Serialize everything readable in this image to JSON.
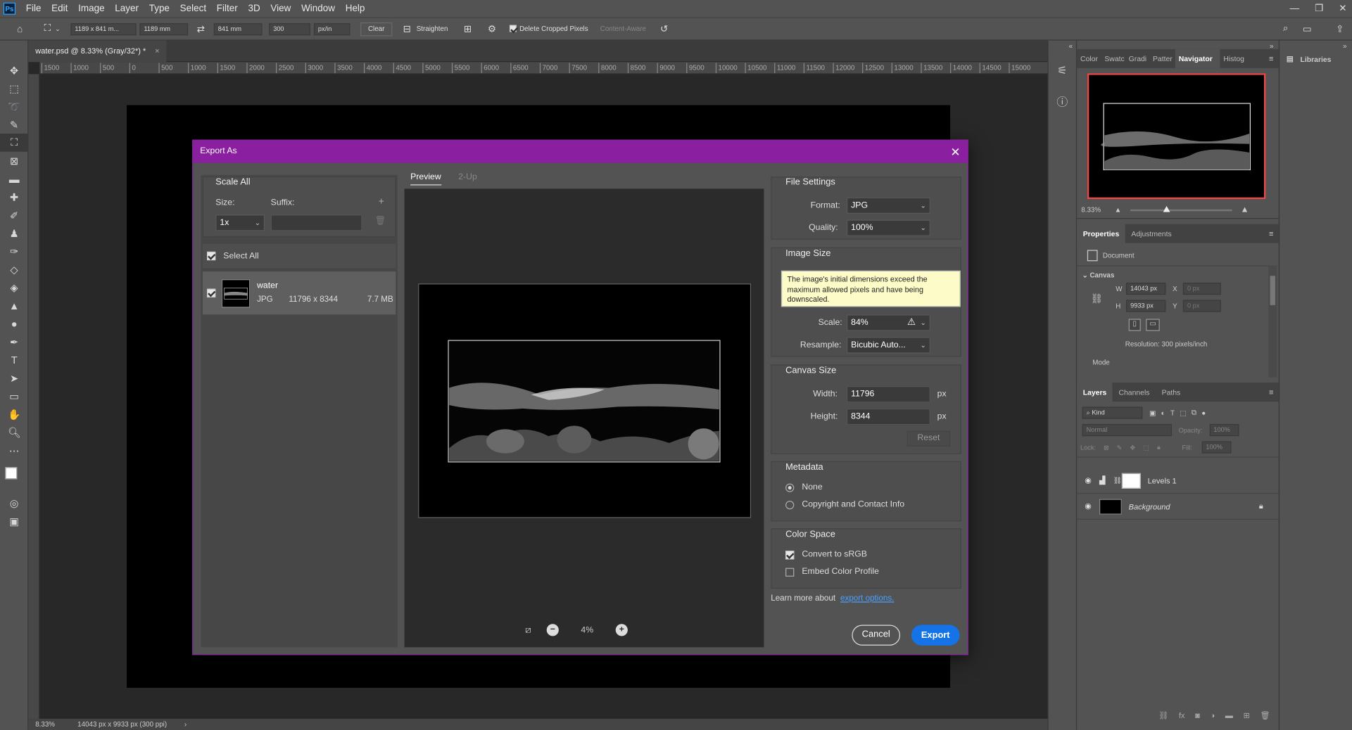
{
  "app": {
    "menu": [
      "File",
      "Edit",
      "Image",
      "Layer",
      "Type",
      "Select",
      "Filter",
      "3D",
      "View",
      "Window",
      "Help"
    ],
    "logo": "Ps"
  },
  "options_bar": {
    "ratio": "1189 x 841 m...",
    "width": "1189 mm",
    "height": "841 mm",
    "resolution": "300",
    "unit": "px/in",
    "clear": "Clear",
    "straighten": "Straighten",
    "delete_cropped": "Delete Cropped Pixels",
    "content_aware": "Content-Aware"
  },
  "document": {
    "tab_title": "water.psd @ 8.33% (Gray/32*) *",
    "ruler_ticks": [
      "1500",
      "1000",
      "500",
      "0",
      "500",
      "1000",
      "1500",
      "2000",
      "2500",
      "3000",
      "3500",
      "4000",
      "4500",
      "5000",
      "5500",
      "6000",
      "6500",
      "7000",
      "7500",
      "8000",
      "8500",
      "9000",
      "9500",
      "10000",
      "10500",
      "11000",
      "11500",
      "12000",
      "12500",
      "13000",
      "13500",
      "14000",
      "14500",
      "15000"
    ],
    "status_zoom": "8.33%",
    "status_info": "14043 px x 9933 px (300 ppi)"
  },
  "navigator": {
    "tabs": [
      "Color",
      "Swatc",
      "Gradi",
      "Patter",
      "Navigator",
      "Histog"
    ],
    "zoom": "8.33%"
  },
  "properties": {
    "tabs": [
      "Properties",
      "Adjustments"
    ],
    "doc_label": "Document",
    "section": "Canvas",
    "w_label": "W",
    "w_value": "14043 px",
    "h_label": "H",
    "h_value": "9933 px",
    "x_label": "X",
    "x_placeholder": "0 px",
    "y_label": "Y",
    "y_placeholder": "0 px",
    "resolution": "Resolution: 300 pixels/inch",
    "mode": "Mode"
  },
  "layers": {
    "tabs": [
      "Layers",
      "Channels",
      "Paths"
    ],
    "kind": "Kind",
    "blend": "Normal",
    "opacity_label": "Opacity:",
    "opacity_value": "100%",
    "lock_label": "Lock:",
    "fill_label": "Fill:",
    "fill_value": "100%",
    "items": [
      "Levels 1",
      "Background"
    ]
  },
  "libraries": {
    "label": "Libraries"
  },
  "dialog": {
    "title": "Export As",
    "scale_all": "Scale All",
    "size_label": "Size:",
    "suffix_label": "Suffix:",
    "size_value": "1x",
    "select_all": "Select All",
    "asset": {
      "name": "water",
      "format": "JPG",
      "dims": "11796 x 8344",
      "filesize": "7.7 MB"
    },
    "preview_tabs": [
      "Preview",
      "2-Up"
    ],
    "zoom": "4%",
    "file_settings": "File Settings",
    "format_label": "Format:",
    "format_value": "JPG",
    "quality_label": "Quality:",
    "quality_value": "100%",
    "image_size": "Image Size",
    "warning": "The image's initial dimensions exceed the maximum allowed pixels and have being downscaled.",
    "scale_label": "Scale:",
    "scale_value": "84%",
    "resample_label": "Resample:",
    "resample_value": "Bicubic Auto...",
    "canvas_size": "Canvas Size",
    "width_label": "Width:",
    "width_value": "11796",
    "height_label": "Height:",
    "height_value": "8344",
    "unit": "px",
    "reset": "Reset",
    "metadata": "Metadata",
    "meta_none": "None",
    "meta_copyright": "Copyright and Contact Info",
    "color_space": "Color Space",
    "convert_srgb": "Convert to sRGB",
    "embed_profile": "Embed Color Profile",
    "learn_more": "Learn more about",
    "export_options": "export options.",
    "cancel": "Cancel",
    "export": "Export"
  },
  "colors": {
    "dialog_title_bg": "#8a1fa0",
    "accent": "#1473e6",
    "nav_frame": "#e84a4a"
  }
}
